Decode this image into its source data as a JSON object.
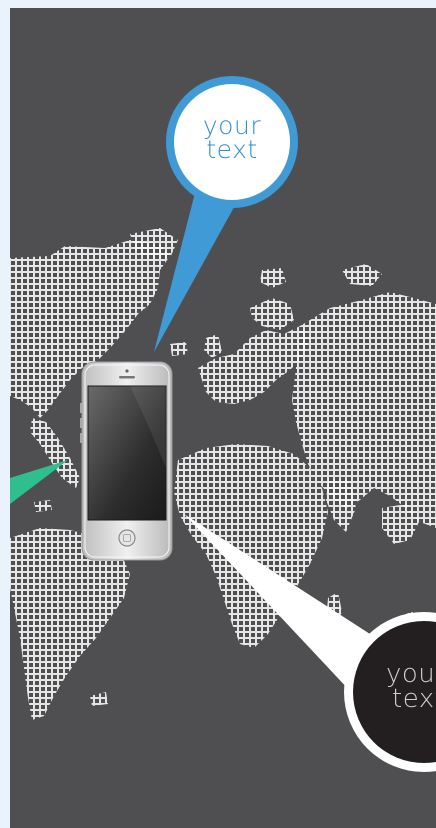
{
  "callouts": [
    {
      "id": "top",
      "text_line1": "your",
      "text_line2": "text",
      "ring_color": "#3f9ad6",
      "fill_color": "#ffffff",
      "text_color": "#2f8fd0"
    },
    {
      "id": "bottom",
      "text_line1": "your",
      "text_line2": "text",
      "ring_color": "#ffffff",
      "fill_color": "#231f20",
      "text_color": "#cfcfcf"
    }
  ],
  "colors": {
    "background": "#4f4f51",
    "map_grid": "#ffffff",
    "left_beam": "#2fbf8f",
    "phone_body": "#d6d6d6"
  },
  "icons": [
    "world-map-grid",
    "smartphone-icon"
  ]
}
